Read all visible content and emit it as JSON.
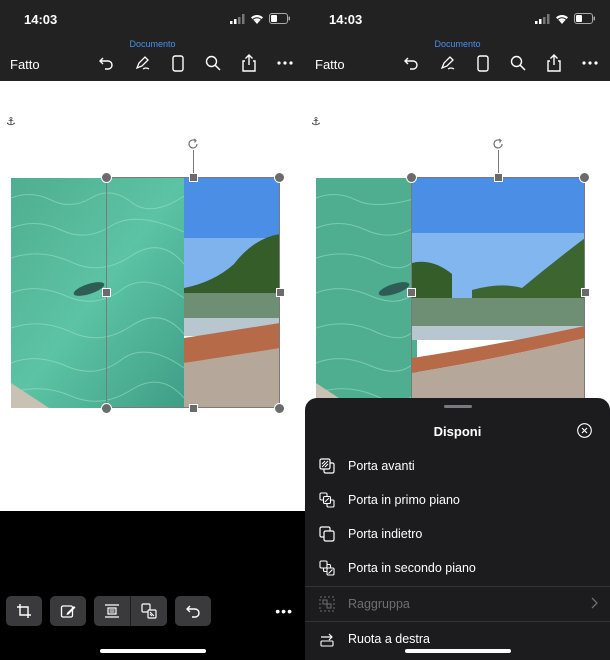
{
  "status": {
    "time": "14:03"
  },
  "toolbar": {
    "document_label": "Documento",
    "done_label": "Fatto",
    "tools": [
      "undo-icon",
      "pen-icon",
      "phone-view-icon",
      "search-icon",
      "share-icon",
      "more-icon"
    ]
  },
  "context_toolbar": {
    "buttons": [
      "crop-icon",
      "edit-image-icon",
      "wrap-text-icon",
      "arrange-icon",
      "undo-icon"
    ],
    "more": "•••"
  },
  "sheet": {
    "title": "Disponi",
    "items": [
      {
        "label": "Porta avanti",
        "icon": "bring-forward-icon",
        "enabled": true
      },
      {
        "label": "Porta in primo piano",
        "icon": "bring-to-front-icon",
        "enabled": true
      },
      {
        "label": "Porta indietro",
        "icon": "send-backward-icon",
        "enabled": true
      },
      {
        "label": "Porta in secondo piano",
        "icon": "send-to-back-icon",
        "enabled": true
      },
      {
        "label": "Raggruppa",
        "icon": "group-icon",
        "enabled": false
      },
      {
        "label": "Ruota a destra",
        "icon": "rotate-right-icon",
        "enabled": true
      }
    ]
  },
  "colors": {
    "toolbar_bg": "#222222",
    "accent": "#4a8ff0",
    "sheet_bg": "#1c1c1e"
  }
}
